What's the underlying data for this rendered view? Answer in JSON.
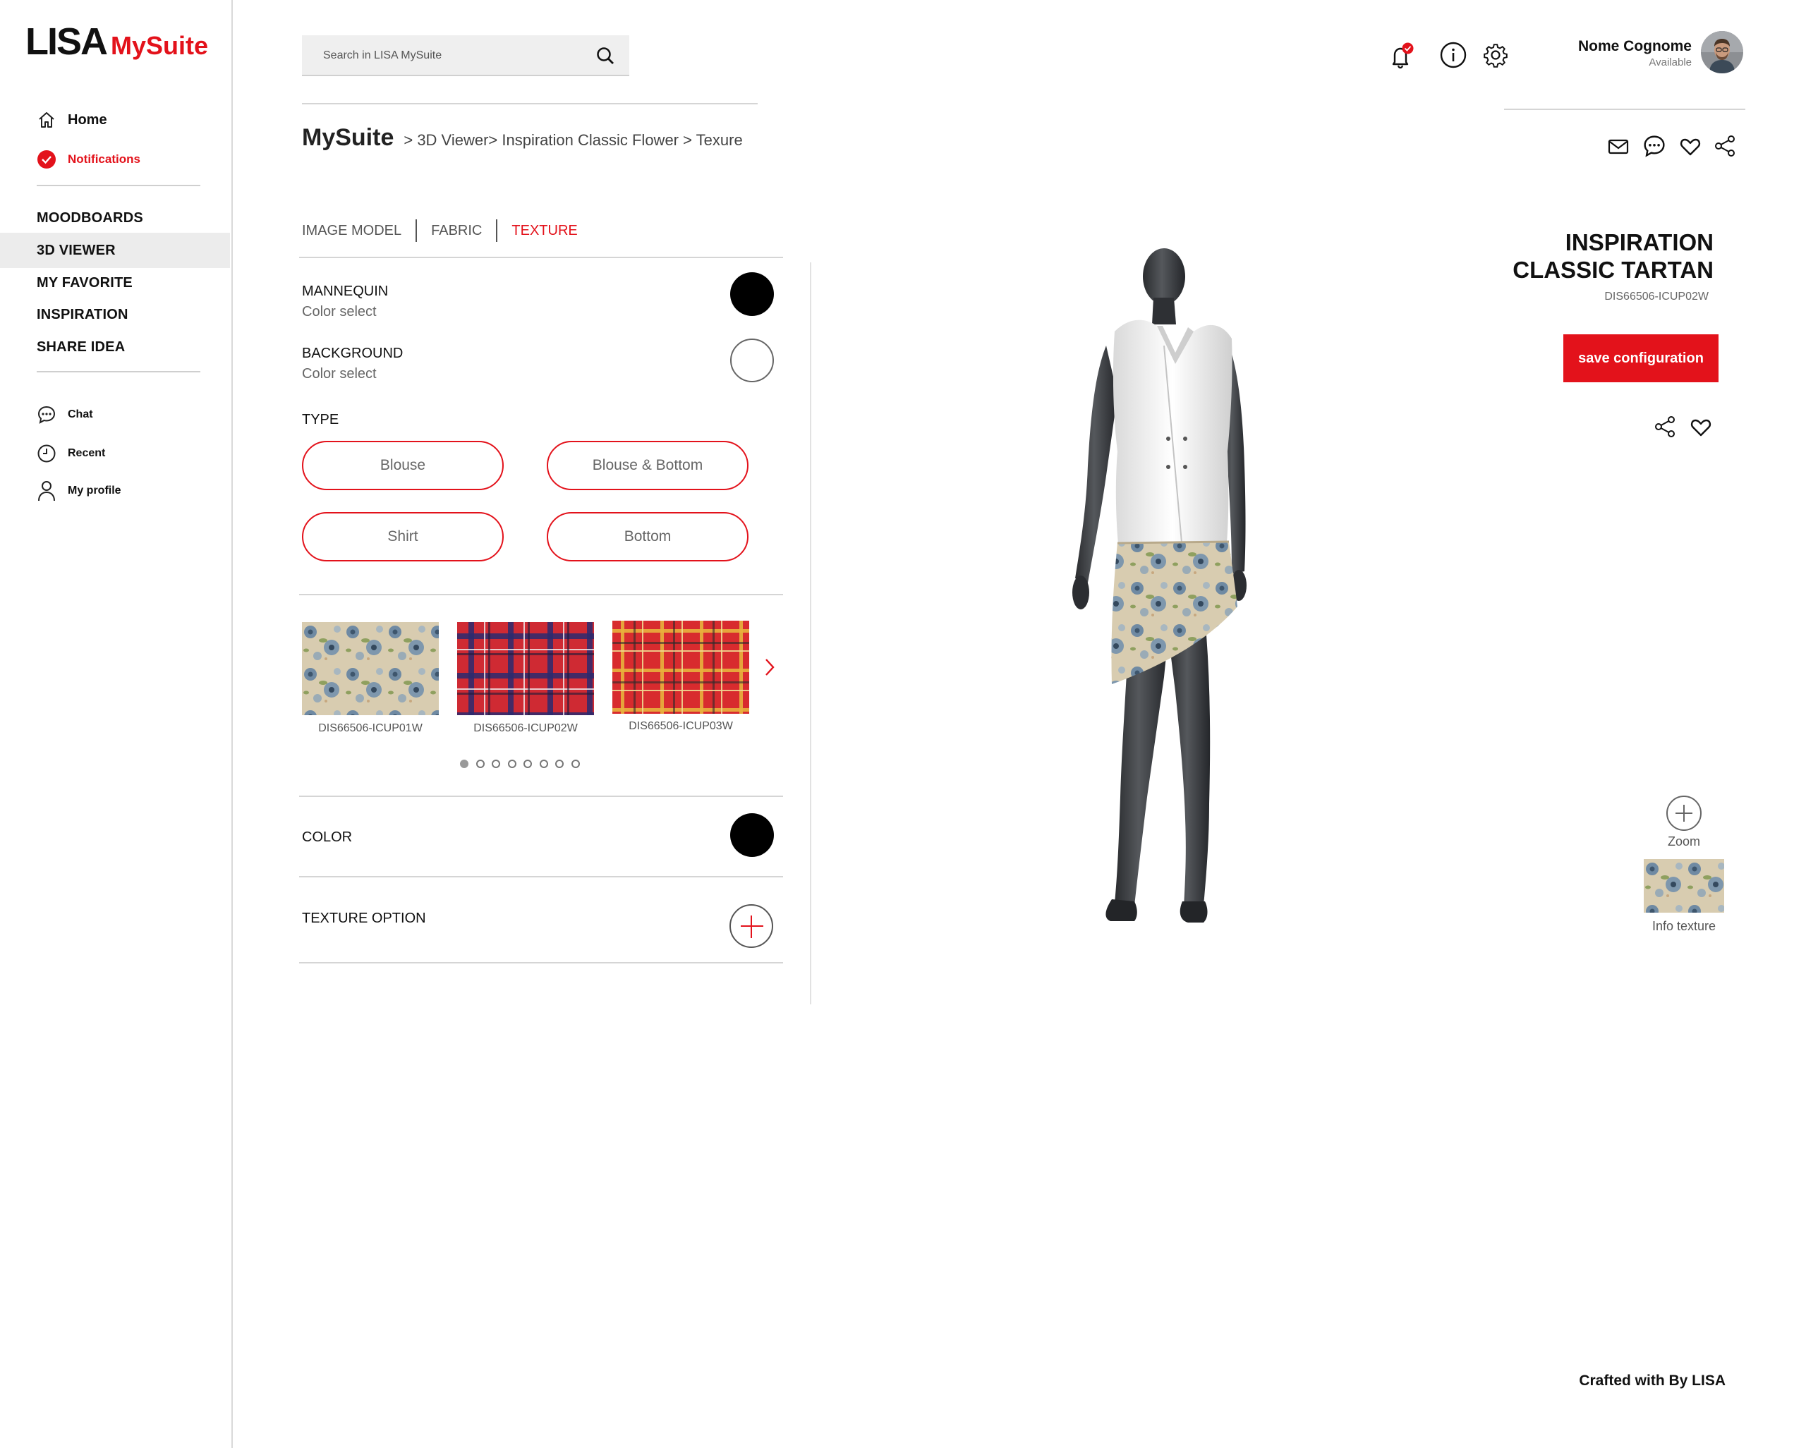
{
  "logo": {
    "part1": "LISA",
    "part2": "MySuite"
  },
  "sidebar": {
    "home": "Home",
    "notifications": "Notifications",
    "nav": [
      "MOODBOARDS",
      "3D VIEWER",
      "MY FAVORITE",
      "INSPIRATION",
      "SHARE IDEA"
    ],
    "active_nav": "3D VIEWER",
    "bottom": {
      "chat": "Chat",
      "recent": "Recent",
      "profile": "My profile"
    }
  },
  "search": {
    "placeholder": "Search in LISA MySuite"
  },
  "user": {
    "name": "Nome Cognome",
    "status": "Available"
  },
  "breadcrumb": {
    "title": "MySuite",
    "path": ">  3D Viewer> Inspiration Classic Flower >  Texure"
  },
  "tabs": [
    "IMAGE MODEL",
    "FABRIC",
    "TEXTURE"
  ],
  "active_tab": "TEXTURE",
  "panel": {
    "mannequin": {
      "label": "MANNEQUIN",
      "sub": "Color select",
      "color": "#000000"
    },
    "background": {
      "label": "BACKGROUND",
      "sub": "Color select",
      "color": "#ffffff"
    },
    "type": {
      "label": "TYPE",
      "options": [
        "Blouse",
        "Blouse & Bottom",
        "Shirt",
        "Bottom"
      ]
    },
    "textures": [
      "DIS66506-ICUP01W",
      "DIS66506-ICUP02W",
      "DIS66506-ICUP03W"
    ],
    "carousel": {
      "pages": 8,
      "current": 1
    },
    "color": {
      "label": "COLOR",
      "value": "#000000"
    },
    "texture_option": {
      "label": "TEXTURE OPTION"
    }
  },
  "product": {
    "title_line1": "INSPIRATION",
    "title_line2": "CLASSIC TARTAN",
    "code": "DIS66506-ICUP02W",
    "save_label": "save configuration",
    "zoom_label": "Zoom",
    "info_label": "Info texture"
  },
  "footer": "Crafted with  By LISA",
  "colors": {
    "accent": "#e3121b",
    "text": "#111111",
    "muted": "#666666",
    "divider": "#d5d5d5"
  }
}
